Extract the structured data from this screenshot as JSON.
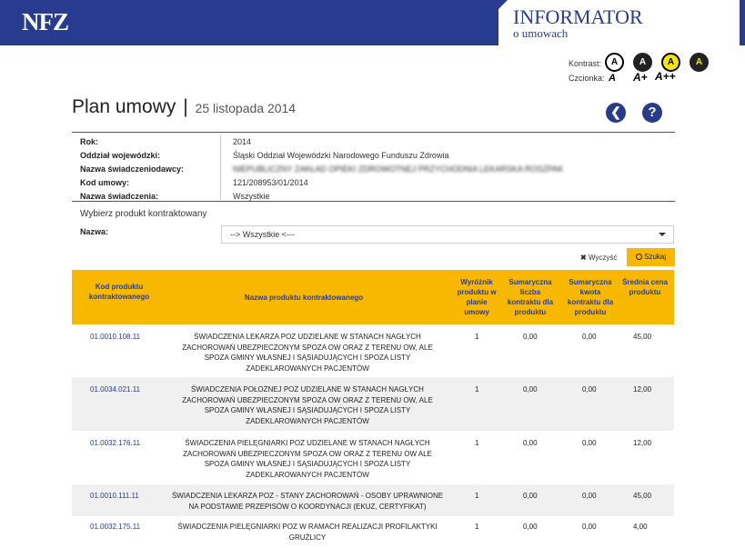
{
  "header": {
    "logo": "NFZ",
    "app_title": "INFORMATOR",
    "app_subtitle": "o umowach"
  },
  "accessibility": {
    "contrast_label": "Kontrast:",
    "font_label": "Czcionka:",
    "contrast_options": [
      "A",
      "A",
      "A",
      "A"
    ],
    "font_options": [
      "A",
      "A+",
      "A++"
    ]
  },
  "page": {
    "title": "Plan umowy",
    "separator": "|",
    "date": "25 listopada 2014"
  },
  "info": [
    {
      "key": "Rok:",
      "value": "2014",
      "blurred": false
    },
    {
      "key": "Oddział wojewódzki:",
      "value": "Śląski Oddział Wojewódzki Narodowego Funduszu Zdrowia",
      "blurred": false
    },
    {
      "key": "Nazwa świadczeniodawcy:",
      "value": "NIEPUBLICZNY ZAKŁAD OPIEKI ZDROWOTNEJ PRZYCHODNIA LEKARSKA ROSZPAK",
      "blurred": true
    },
    {
      "key": "Kod umowy:",
      "value": "121/208953/01/2014",
      "blurred": false
    },
    {
      "key": "Nazwa świadczenia:",
      "value": "Wszystkie",
      "blurred": false
    }
  ],
  "filter": {
    "heading": "Wybierz produkt kontraktowany",
    "name_label": "Nazwa:",
    "selected": "--> Wszystkie <---",
    "clear_label": "Wyczyść",
    "search_label": "Szukaj"
  },
  "table": {
    "headers": {
      "code": "Kod produktu kontraktowanego",
      "name": "Nazwa produktu kontraktowanego",
      "flag": "Wyróżnik produktu w planie umowy",
      "qty": "Sumaryczna liczba kontraktu dla produktu",
      "amount": "Sumaryczna kwota kontraktu dla produktu",
      "price": "Średnia cena produktu"
    },
    "rows": [
      {
        "code": "01.0010.108.11",
        "name": "ŚWIADCZENIA LEKARZA POZ UDZIELANE W STANACH NAGŁYCH ZACHOROWAŃ UBEZPIECZONYM SPOZA OW ORAZ Z TERENU OW, ALE SPOZA GMINY WŁASNEJ I SĄSIADUJĄCYCH I SPOZA LISTY ZADEKLAROWANYCH PACJENTÓW",
        "flag": "1",
        "qty": "0,00",
        "amount": "0,00",
        "price": "45,00"
      },
      {
        "code": "01.0034.021.11",
        "name": "ŚWIADCZENIA POŁOŻNEJ POZ UDZIELANE W STANACH NAGŁYCH ZACHOROWAŃ UBEZPIECZONYM SPOZA OW ORAZ Z TERENU OW, ALE SPOZA GMINY WŁASNEJ I SĄSIADUJĄCYCH I SPOZA LISTY ZADEKLAROWANYCH PACJENTÓW",
        "flag": "1",
        "qty": "0,00",
        "amount": "0,00",
        "price": "12,00"
      },
      {
        "code": "01.0032.176.11",
        "name": "ŚWIADCZENIA PIELĘGNIARKI POZ UDZIELANE W STANACH NAGŁYCH ZACHOROWAŃ UBEZPIECZONYM SPOZA OW ORAZ Z TERENU OW ALE SPOZA GMINY WŁASNEJ I SĄSIADUJĄCYCH I SPOZA LISTY ZADEKLAROWANYCH PACJENTÓW",
        "flag": "1",
        "qty": "0,00",
        "amount": "0,00",
        "price": "12,00"
      },
      {
        "code": "01.0010.111.11",
        "name": "ŚWIADCZENIA LEKARZA POZ - STANY ZACHOROWAŃ - OSOBY UPRAWNIONE NA PODSTAWIE PRZEPISÓW O KOORDYNACJI (EKUZ, CERTYFIKAT)",
        "flag": "1",
        "qty": "0,00",
        "amount": "0,00",
        "price": "45,00"
      },
      {
        "code": "01.0032.175.11",
        "name": "ŚWIADCZENIA PIELĘGNIARKI POZ W RAMACH REALIZACJI PROFILAKTYKI GRUŹLICY",
        "flag": "1",
        "qty": "0,00",
        "amount": "0,00",
        "price": "4,00"
      }
    ]
  },
  "colors": {
    "brand_blue": "#283c8f",
    "accent_yellow": "#f9b800"
  }
}
